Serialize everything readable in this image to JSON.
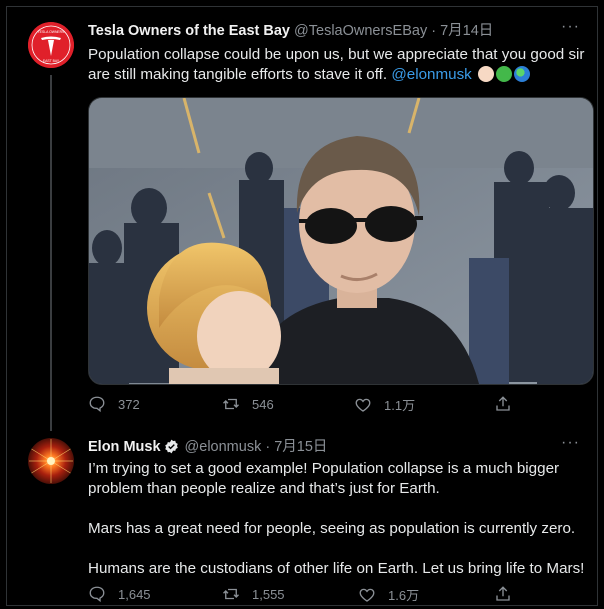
{
  "tweet1": {
    "author_name": "Tesla Owners of the East Bay",
    "handle": "@TeslaOwnersEBay",
    "separator": " · ",
    "date": "7月14日",
    "text": "Population collapse could be upon us, but we appreciate that you good sir are still making tangible efforts to stave it off.",
    "mention": "@elonmusk",
    "emoji_icons": [
      "baby-face-icon",
      "green-heart-icon",
      "globe-icon"
    ],
    "avatar_text_top": "TESLA OWNERS",
    "avatar_text_bottom": "EAST BAY",
    "photo_icon": "photo-image",
    "actions": {
      "reply_count": "372",
      "retweet_count": "546",
      "like_count": "1.1万"
    }
  },
  "tweet2": {
    "author_name": "Elon Musk",
    "verified_icon": "verified-badge-icon",
    "handle": "@elonmusk",
    "separator": " · ",
    "date": "7月15日",
    "paragraphs": [
      "I’m trying to set a good example! Population collapse is a much bigger problem than people realize and that’s just for Earth.",
      "Mars has a great need for people, seeing as population is currently zero.",
      "Humans are the custodians of other life on Earth. Let us bring life to Mars!"
    ],
    "actions": {
      "reply_count": "1,645",
      "retweet_count": "1,555",
      "like_count": "1.6万"
    }
  },
  "more_label": "···",
  "colors": {
    "background": "#000000",
    "link": "#3b9ce8",
    "muted": "#8b9096",
    "tesla_red": "#e0202a"
  }
}
